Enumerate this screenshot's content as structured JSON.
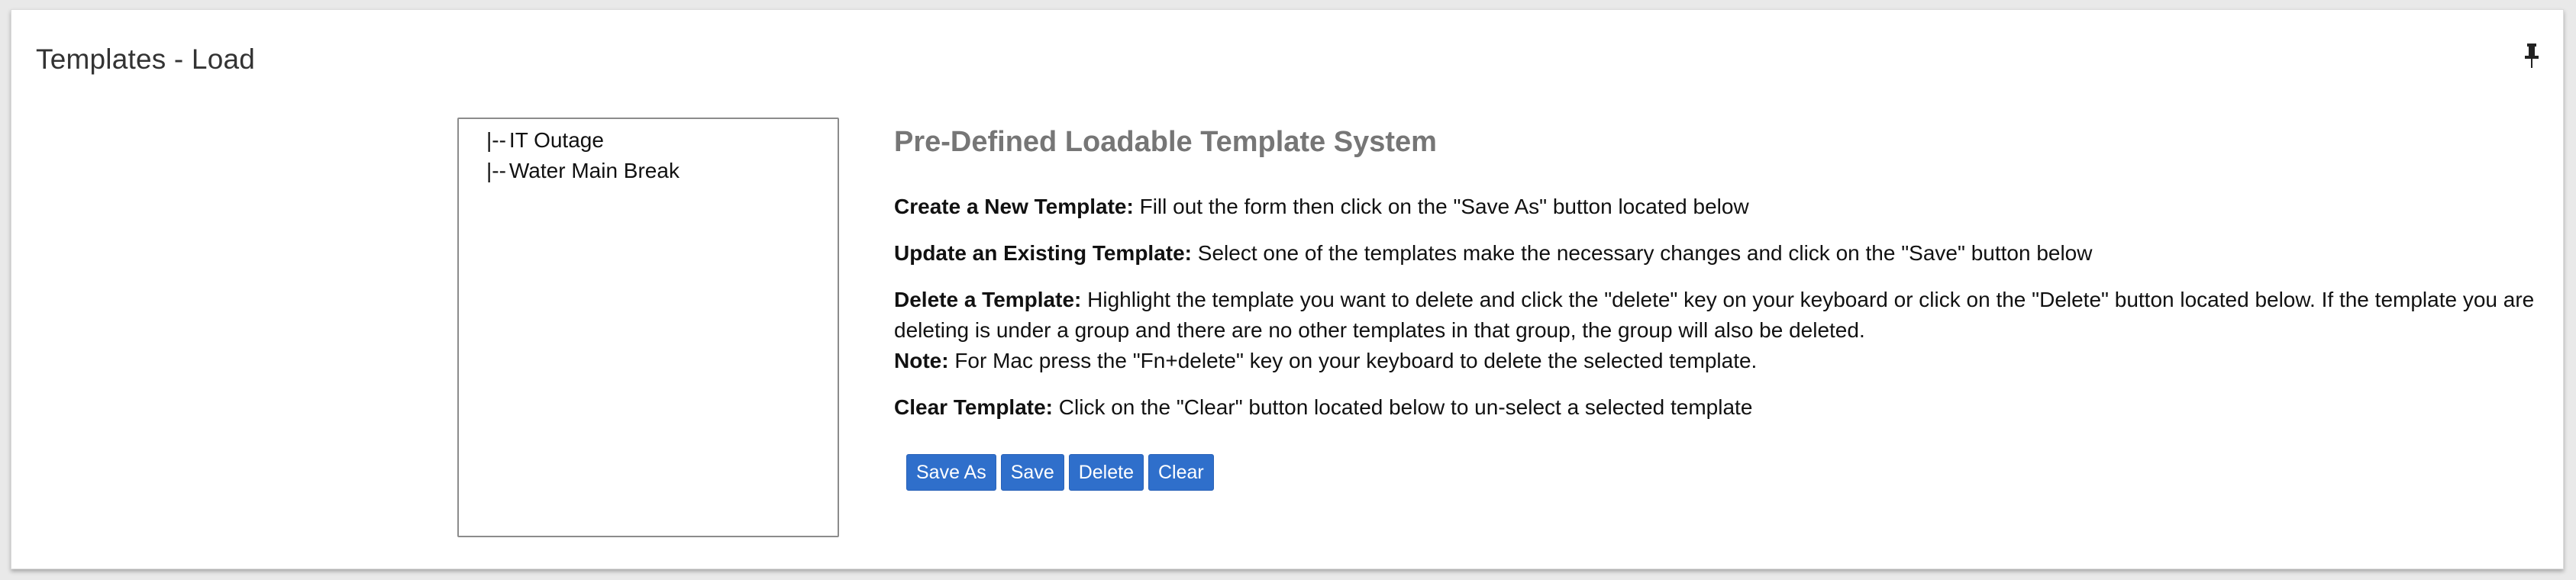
{
  "panel": {
    "title": "Templates - Load",
    "pin_icon": "pin-icon"
  },
  "tree": {
    "items": [
      {
        "prefix": "|--",
        "label": "IT Outage"
      },
      {
        "prefix": "|--",
        "label": "Water Main Break"
      }
    ]
  },
  "info": {
    "heading": "Pre-Defined Loadable Template System",
    "create": {
      "label": "Create a New Template:",
      "text": " Fill out the form then click on the \"Save As\" button located below"
    },
    "update": {
      "label": "Update an Existing Template:",
      "text": " Select one of the templates make the necessary changes and click on the \"Save\" button below"
    },
    "delete": {
      "label": "Delete a Template:",
      "text": " Highlight the template you want to delete and click the \"delete\" key on your keyboard or click on the \"Delete\" button located below. If the template you are deleting is under a group and there are no other templates in that group, the group will also be deleted."
    },
    "note": {
      "label": "Note:",
      "text": " For Mac press the \"Fn+delete\" key on your keyboard to delete the selected template."
    },
    "clear": {
      "label": "Clear Template:",
      "text": " Click on the \"Clear\" button located below to un-select a selected template"
    }
  },
  "buttons": {
    "save_as": "Save As",
    "save": "Save",
    "delete": "Delete",
    "clear": "Clear"
  },
  "colors": {
    "button": "#2f6fcb",
    "heading": "#767676"
  }
}
